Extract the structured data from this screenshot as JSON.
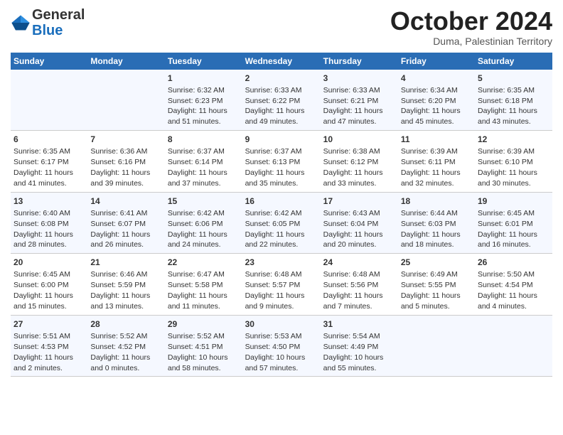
{
  "logo": {
    "general": "General",
    "blue": "Blue"
  },
  "header": {
    "month": "October 2024",
    "location": "Duma, Palestinian Territory"
  },
  "days_of_week": [
    "Sunday",
    "Monday",
    "Tuesday",
    "Wednesday",
    "Thursday",
    "Friday",
    "Saturday"
  ],
  "weeks": [
    [
      {
        "day": "",
        "text": ""
      },
      {
        "day": "",
        "text": ""
      },
      {
        "day": "1",
        "text": "Sunrise: 6:32 AM\nSunset: 6:23 PM\nDaylight: 11 hours and 51 minutes."
      },
      {
        "day": "2",
        "text": "Sunrise: 6:33 AM\nSunset: 6:22 PM\nDaylight: 11 hours and 49 minutes."
      },
      {
        "day": "3",
        "text": "Sunrise: 6:33 AM\nSunset: 6:21 PM\nDaylight: 11 hours and 47 minutes."
      },
      {
        "day": "4",
        "text": "Sunrise: 6:34 AM\nSunset: 6:20 PM\nDaylight: 11 hours and 45 minutes."
      },
      {
        "day": "5",
        "text": "Sunrise: 6:35 AM\nSunset: 6:18 PM\nDaylight: 11 hours and 43 minutes."
      }
    ],
    [
      {
        "day": "6",
        "text": "Sunrise: 6:35 AM\nSunset: 6:17 PM\nDaylight: 11 hours and 41 minutes."
      },
      {
        "day": "7",
        "text": "Sunrise: 6:36 AM\nSunset: 6:16 PM\nDaylight: 11 hours and 39 minutes."
      },
      {
        "day": "8",
        "text": "Sunrise: 6:37 AM\nSunset: 6:14 PM\nDaylight: 11 hours and 37 minutes."
      },
      {
        "day": "9",
        "text": "Sunrise: 6:37 AM\nSunset: 6:13 PM\nDaylight: 11 hours and 35 minutes."
      },
      {
        "day": "10",
        "text": "Sunrise: 6:38 AM\nSunset: 6:12 PM\nDaylight: 11 hours and 33 minutes."
      },
      {
        "day": "11",
        "text": "Sunrise: 6:39 AM\nSunset: 6:11 PM\nDaylight: 11 hours and 32 minutes."
      },
      {
        "day": "12",
        "text": "Sunrise: 6:39 AM\nSunset: 6:10 PM\nDaylight: 11 hours and 30 minutes."
      }
    ],
    [
      {
        "day": "13",
        "text": "Sunrise: 6:40 AM\nSunset: 6:08 PM\nDaylight: 11 hours and 28 minutes."
      },
      {
        "day": "14",
        "text": "Sunrise: 6:41 AM\nSunset: 6:07 PM\nDaylight: 11 hours and 26 minutes."
      },
      {
        "day": "15",
        "text": "Sunrise: 6:42 AM\nSunset: 6:06 PM\nDaylight: 11 hours and 24 minutes."
      },
      {
        "day": "16",
        "text": "Sunrise: 6:42 AM\nSunset: 6:05 PM\nDaylight: 11 hours and 22 minutes."
      },
      {
        "day": "17",
        "text": "Sunrise: 6:43 AM\nSunset: 6:04 PM\nDaylight: 11 hours and 20 minutes."
      },
      {
        "day": "18",
        "text": "Sunrise: 6:44 AM\nSunset: 6:03 PM\nDaylight: 11 hours and 18 minutes."
      },
      {
        "day": "19",
        "text": "Sunrise: 6:45 AM\nSunset: 6:01 PM\nDaylight: 11 hours and 16 minutes."
      }
    ],
    [
      {
        "day": "20",
        "text": "Sunrise: 6:45 AM\nSunset: 6:00 PM\nDaylight: 11 hours and 15 minutes."
      },
      {
        "day": "21",
        "text": "Sunrise: 6:46 AM\nSunset: 5:59 PM\nDaylight: 11 hours and 13 minutes."
      },
      {
        "day": "22",
        "text": "Sunrise: 6:47 AM\nSunset: 5:58 PM\nDaylight: 11 hours and 11 minutes."
      },
      {
        "day": "23",
        "text": "Sunrise: 6:48 AM\nSunset: 5:57 PM\nDaylight: 11 hours and 9 minutes."
      },
      {
        "day": "24",
        "text": "Sunrise: 6:48 AM\nSunset: 5:56 PM\nDaylight: 11 hours and 7 minutes."
      },
      {
        "day": "25",
        "text": "Sunrise: 6:49 AM\nSunset: 5:55 PM\nDaylight: 11 hours and 5 minutes."
      },
      {
        "day": "26",
        "text": "Sunrise: 5:50 AM\nSunset: 4:54 PM\nDaylight: 11 hours and 4 minutes."
      }
    ],
    [
      {
        "day": "27",
        "text": "Sunrise: 5:51 AM\nSunset: 4:53 PM\nDaylight: 11 hours and 2 minutes."
      },
      {
        "day": "28",
        "text": "Sunrise: 5:52 AM\nSunset: 4:52 PM\nDaylight: 11 hours and 0 minutes."
      },
      {
        "day": "29",
        "text": "Sunrise: 5:52 AM\nSunset: 4:51 PM\nDaylight: 10 hours and 58 minutes."
      },
      {
        "day": "30",
        "text": "Sunrise: 5:53 AM\nSunset: 4:50 PM\nDaylight: 10 hours and 57 minutes."
      },
      {
        "day": "31",
        "text": "Sunrise: 5:54 AM\nSunset: 4:49 PM\nDaylight: 10 hours and 55 minutes."
      },
      {
        "day": "",
        "text": ""
      },
      {
        "day": "",
        "text": ""
      }
    ]
  ]
}
